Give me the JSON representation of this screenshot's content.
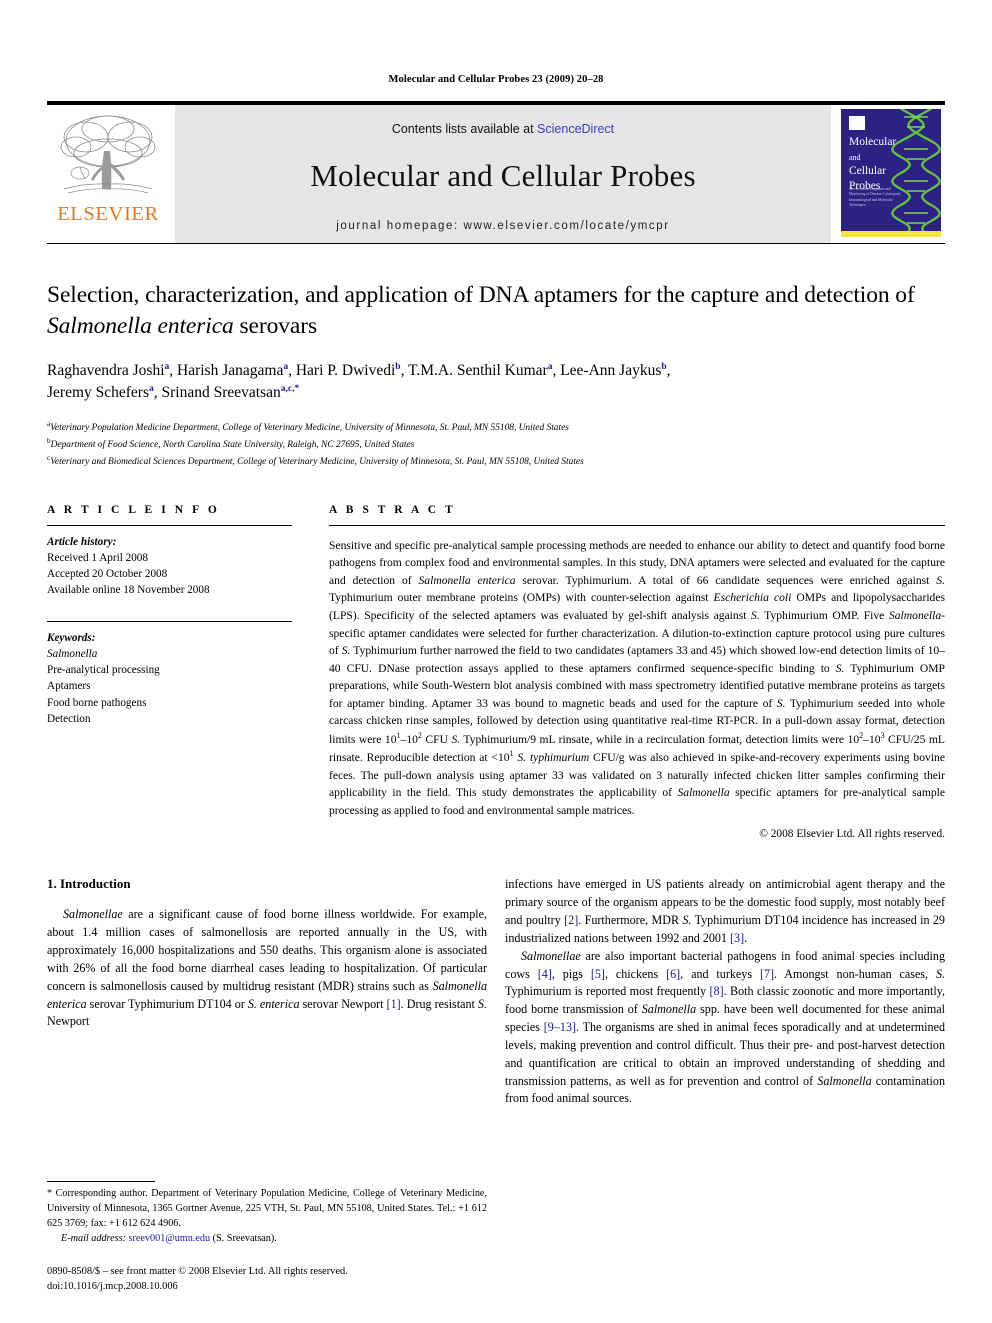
{
  "running_head": "Molecular and Cellular Probes 23 (2009) 20–28",
  "masthead": {
    "publisher_wordmark": "ELSEVIER",
    "contents_prefix": "Contents lists available at ",
    "sciencedirect_link": "ScienceDirect",
    "journal_name": "Molecular and Cellular Probes",
    "journal_homepage": "journal homepage: www.elsevier.com/locate/ymcpr",
    "cover": {
      "line1": "Molecular",
      "line2": "and",
      "line3": "Cellular",
      "line4": "Probes",
      "subtitle": "The Location, Diagnosis and Monitoring of Disease: Cytological, Immunological and Molecular Techniques"
    },
    "link_color": "#3b3bbf",
    "brand_color": "#E87722",
    "cover_background": "#2b2283",
    "helix_color": "#62c23c"
  },
  "article": {
    "title_part1": "Selection, characterization, and application of DNA aptamers for the capture and detection of ",
    "title_italic": "Salmonella enterica",
    "title_part2": " serovars",
    "authors_line1": "Raghavendra Joshi",
    "authors": [
      {
        "name": "Raghavendra Joshi",
        "sup": "a"
      },
      {
        "name": "Harish Janagama",
        "sup": "a"
      },
      {
        "name": "Hari P. Dwivedi",
        "sup": "b"
      },
      {
        "name": "T.M.A. Senthil Kumar",
        "sup": "a"
      },
      {
        "name": "Lee-Ann Jaykus",
        "sup": "b"
      },
      {
        "name": "Jeremy Schefers",
        "sup": "a"
      },
      {
        "name": "Srinand Sreevatsan",
        "sup": "a,c,*"
      }
    ],
    "affiliations": [
      {
        "mark": "a",
        "text": "Veterinary Population Medicine Department, College of Veterinary Medicine, University of Minnesota, St. Paul, MN 55108, United States"
      },
      {
        "mark": "b",
        "text": "Department of Food Science, North Carolina State University, Raleigh, NC 27695, United States"
      },
      {
        "mark": "c",
        "text": "Veterinary and Biomedical Sciences Department, College of Veterinary Medicine, University of Minnesota, St. Paul, MN 55108, United States"
      }
    ]
  },
  "article_info": {
    "heading": "A R T I C L E  I N F O",
    "history_label": "Article history:",
    "history": [
      "Received 1 April 2008",
      "Accepted 20 October 2008",
      "Available online 18 November 2008"
    ],
    "keywords_label": "Keywords:",
    "keywords": [
      "Salmonella",
      "Pre-analytical processing",
      "Aptamers",
      "Food borne pathogens",
      "Detection"
    ]
  },
  "abstract": {
    "heading": "A B S T R A C T",
    "copyright": "© 2008 Elsevier Ltd. All rights reserved."
  },
  "introduction": {
    "heading": "1. Introduction",
    "left_paragraph_lead": "Salmonellae",
    "right_para2_lead": "Salmonellae"
  },
  "footnotes": {
    "corresponding": "* Corresponding author. Department of Veterinary Population Medicine, College of Veterinary Medicine, University of Minnesota, 1365 Gortner Avenue, 225 VTH, St. Paul, MN 55108, United States. Tel.: +1 612 625 3769; fax: +1 612 624 4906.",
    "email_label": "E-mail address:",
    "email": "sreev001@umn.edu",
    "email_suffix": "(S. Sreevatsan).",
    "issn_line": "0890-8508/$ – see front matter © 2008 Elsevier Ltd. All rights reserved.",
    "doi_line": "doi:10.1016/j.mcp.2008.10.006"
  }
}
